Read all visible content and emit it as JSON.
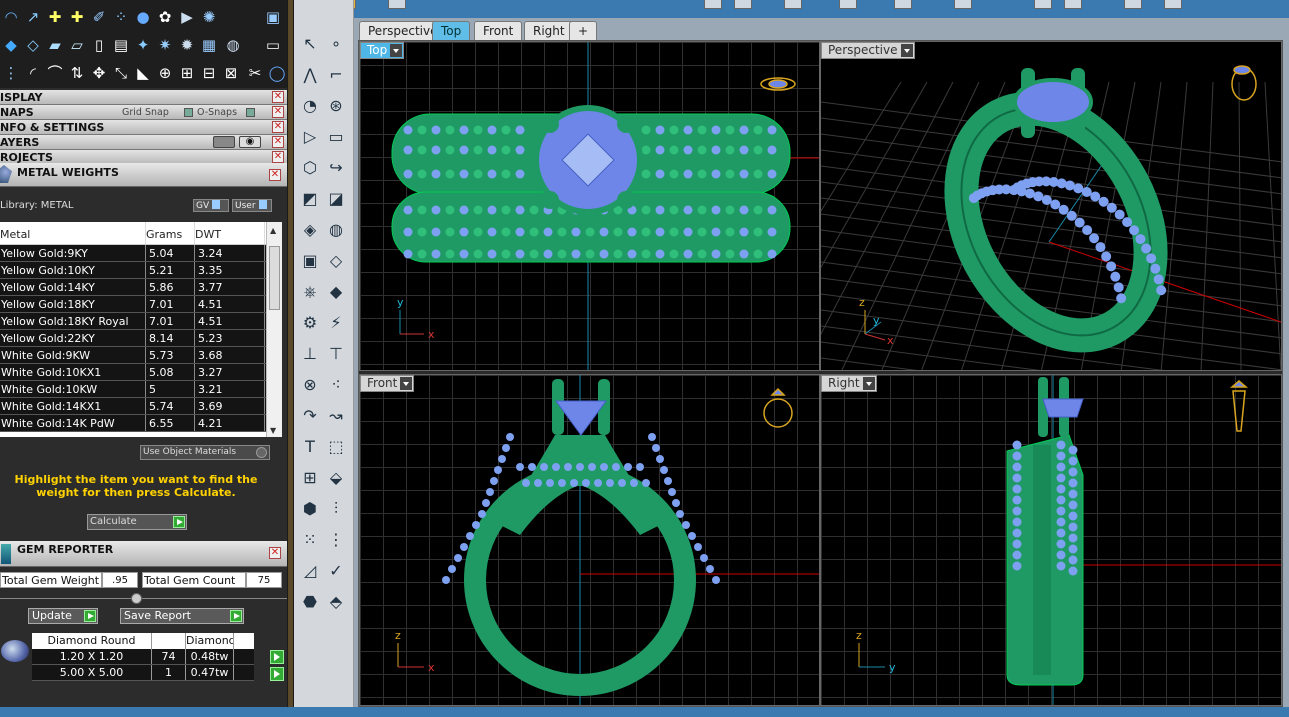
{
  "left_panel": {
    "sections": {
      "display": "ISPLAY",
      "snaps": "NAPS",
      "grid_snap": "Grid Snap",
      "o_snaps": "O-Snaps",
      "info": "NFO & SETTINGS",
      "layers": "AYERS",
      "projects": "ROJECTS"
    },
    "metal_weights": {
      "title": "METAL WEIGHTS",
      "library_label": "Library: METAL",
      "gv_label": "GV",
      "user_label": "User",
      "columns": [
        "Metal",
        "Grams",
        "DWT"
      ],
      "rows": [
        {
          "metal": "Yellow Gold:9KY",
          "grams": "5.04",
          "dwt": "3.24"
        },
        {
          "metal": "Yellow Gold:10KY",
          "grams": "5.21",
          "dwt": "3.35"
        },
        {
          "metal": "Yellow Gold:14KY",
          "grams": "5.86",
          "dwt": "3.77"
        },
        {
          "metal": "Yellow Gold:18KY",
          "grams": "7.01",
          "dwt": "4.51"
        },
        {
          "metal": "Yellow Gold:18KY Royal",
          "grams": "7.01",
          "dwt": "4.51"
        },
        {
          "metal": "Yellow Gold:22KY",
          "grams": "8.14",
          "dwt": "5.23"
        },
        {
          "metal": "White Gold:9KW",
          "grams": "5.73",
          "dwt": "3.68"
        },
        {
          "metal": "White Gold:10KX1",
          "grams": "5.08",
          "dwt": "3.27"
        },
        {
          "metal": "White Gold:10KW",
          "grams": "5",
          "dwt": "3.21"
        },
        {
          "metal": "White Gold:14KX1",
          "grams": "5.74",
          "dwt": "3.69"
        },
        {
          "metal": "White Gold:14K PdW",
          "grams": "6.55",
          "dwt": "4.21"
        }
      ],
      "use_object_materials": "Use Object Materials",
      "hint": "Highlight the item you want to find the weight for then press Calculate.",
      "calculate_label": "Calculate"
    },
    "gem_reporter": {
      "title": "GEM REPORTER",
      "total_weight_label": "Total Gem Weight",
      "total_weight_value": ".95",
      "total_count_label": "Total Gem Count",
      "total_count_value": "75",
      "update_label": "Update",
      "save_report_label": "Save Report",
      "columns": [
        "Diamond Round",
        "",
        "Diamond"
      ],
      "rows": [
        {
          "size": "1.20 X 1.20",
          "count": "74",
          "weight": "0.48tw"
        },
        {
          "size": "5.00 X 5.00",
          "count": "1",
          "weight": "0.47tw"
        }
      ]
    }
  },
  "viewport_tabs": [
    {
      "label": "Perspective",
      "active": false
    },
    {
      "label": "Top",
      "active": true
    },
    {
      "label": "Front",
      "active": false
    },
    {
      "label": "Right",
      "active": false
    },
    {
      "label": "+",
      "active": false
    }
  ],
  "viewports": {
    "top": {
      "label": "Top",
      "axis1": "y",
      "axis2": "x"
    },
    "perspective": {
      "label": "Perspective",
      "axis1": "z",
      "axis2": "y",
      "axis3": "x"
    },
    "front": {
      "label": "Front",
      "axis1": "z",
      "axis2": "x"
    },
    "right": {
      "label": "Right",
      "axis1": "z",
      "axis2": "y"
    }
  },
  "colors": {
    "ring": "#1f9a64",
    "gem": "#7ea0f0",
    "accent": "#4fb6e8"
  }
}
